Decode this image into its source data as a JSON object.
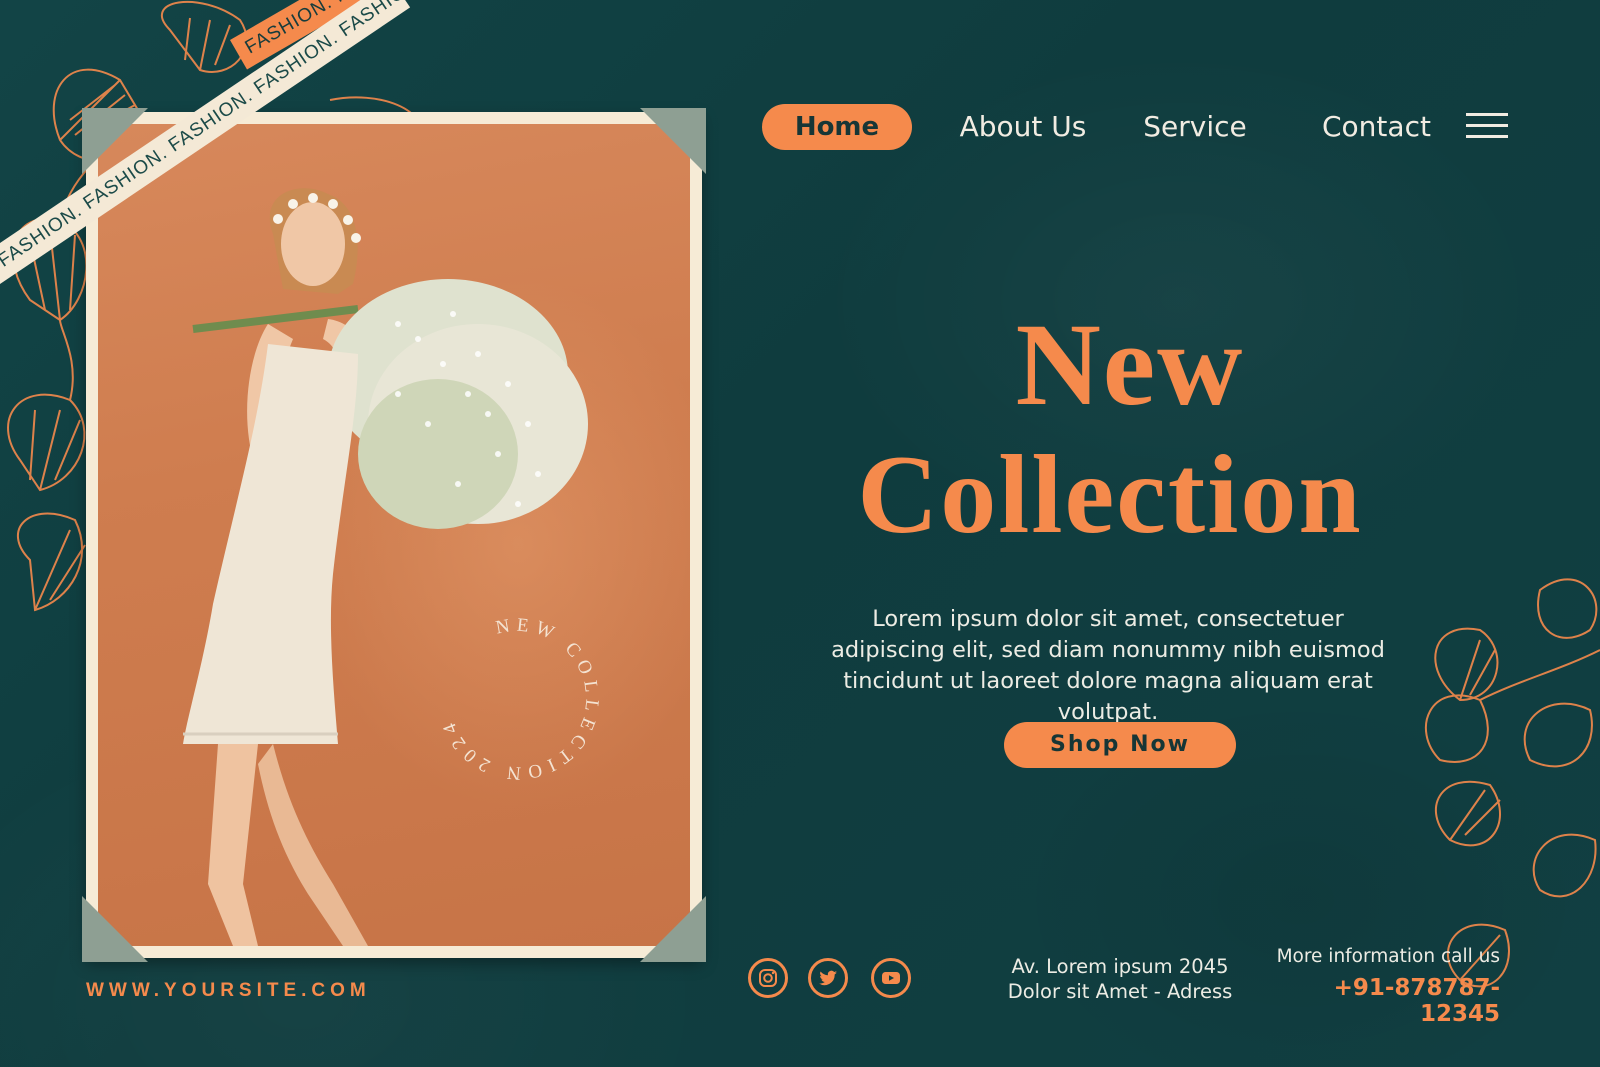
{
  "ribbons": {
    "orange_text": "FASHION. FASHION. FASHION. FASHION. FASHION.",
    "cream_text": "N. FASHION. FASHION. FASHION. FASHION. FASHION. FASHION."
  },
  "nav": {
    "items": [
      {
        "label": "Home",
        "active": true
      },
      {
        "label": "About Us",
        "active": false
      },
      {
        "label": "Service",
        "active": false
      },
      {
        "label": "Contact",
        "active": false
      }
    ],
    "menu_icon": "hamburger-menu-icon"
  },
  "photo": {
    "stamp_text": "NEW COLLECTION 2024",
    "corner_color": "#8e9f93"
  },
  "hero": {
    "title_line1": "New",
    "title_line2": "Collection",
    "body": "Lorem ipsum dolor sit amet, consectetuer adipiscing elit, sed diam nonummy nibh euismod tincidunt ut laoreet dolore magna aliquam erat volutpat.",
    "cta_label": "Shop Now"
  },
  "footer": {
    "site_url": "WWW.YOURSITE.COM",
    "social_icons": [
      "instagram-icon",
      "twitter-icon",
      "youtube-icon"
    ],
    "address_line1": "Av. Lorem ipsum 2045",
    "address_line2": "Dolor sit Amet - Adress",
    "contact_label": "More information call us",
    "contact_phone": "+91-878787-12345"
  },
  "colors": {
    "background": "#0f3e40",
    "accent": "#f58a4c",
    "cream": "#f6ebd6",
    "text": "#f1ece2"
  }
}
